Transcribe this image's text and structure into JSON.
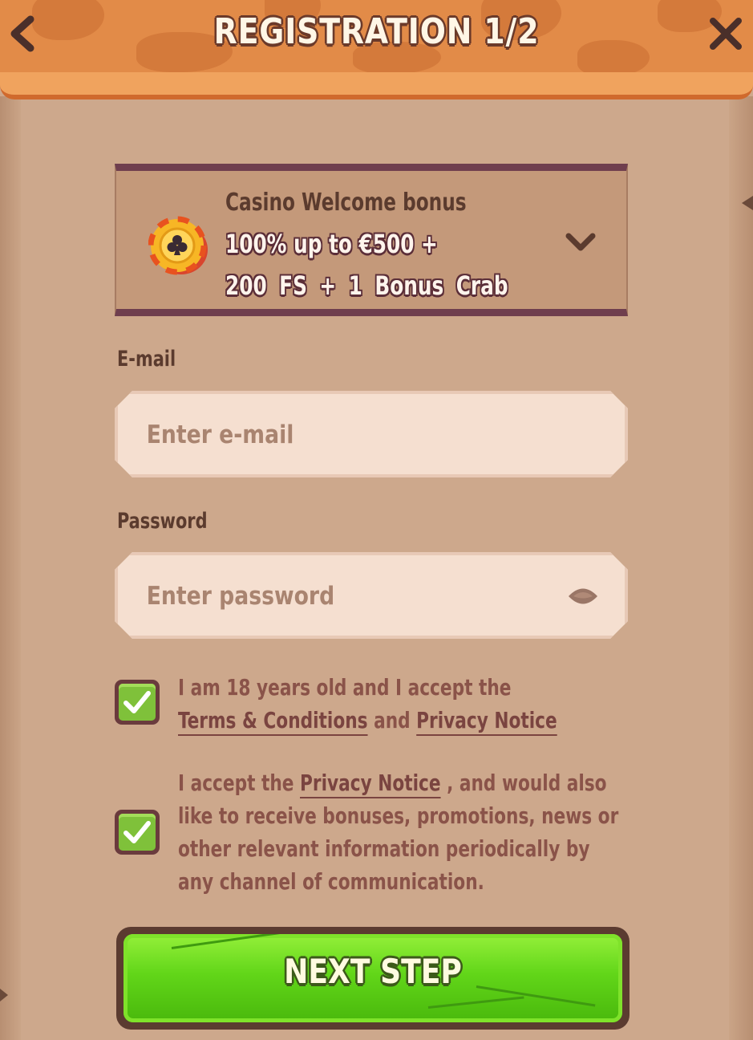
{
  "header": {
    "title": "REGISTRATION 1/2",
    "back_icon": "chevron-left-icon",
    "close_icon": "close-icon"
  },
  "bonus": {
    "label": "Casino Welcome bonus",
    "line1": "100% up to €500 +",
    "line2": "200 FS + 1 Bonus Crab",
    "icon": "casino-chip-icon",
    "toggle_icon": "chevron-down-icon"
  },
  "email": {
    "label": "E-mail",
    "placeholder": "Enter e-mail",
    "value": ""
  },
  "password": {
    "label": "Password",
    "placeholder": "Enter password",
    "value": "",
    "toggle_icon": "eye-icon"
  },
  "consent": {
    "age": {
      "checked": true,
      "text_before": "I am 18 years old and I accept the",
      "terms_link": "Terms & Conditions",
      "and": "and",
      "privacy_link": "Privacy Notice"
    },
    "marketing": {
      "checked": true,
      "text_before": "I accept the",
      "privacy_link": "Privacy Notice",
      "text_after": ", and would also like to receive bonuses, promotions, news or other relevant information periodically by any channel of communication."
    }
  },
  "next_button": {
    "label": "NEXT STEP"
  },
  "colors": {
    "header_orange": "#e28b48",
    "panel_tan": "#cda88c",
    "accent_green": "#62d619",
    "text_brown": "#5b3b2e",
    "link_mauve": "#8a5349"
  }
}
